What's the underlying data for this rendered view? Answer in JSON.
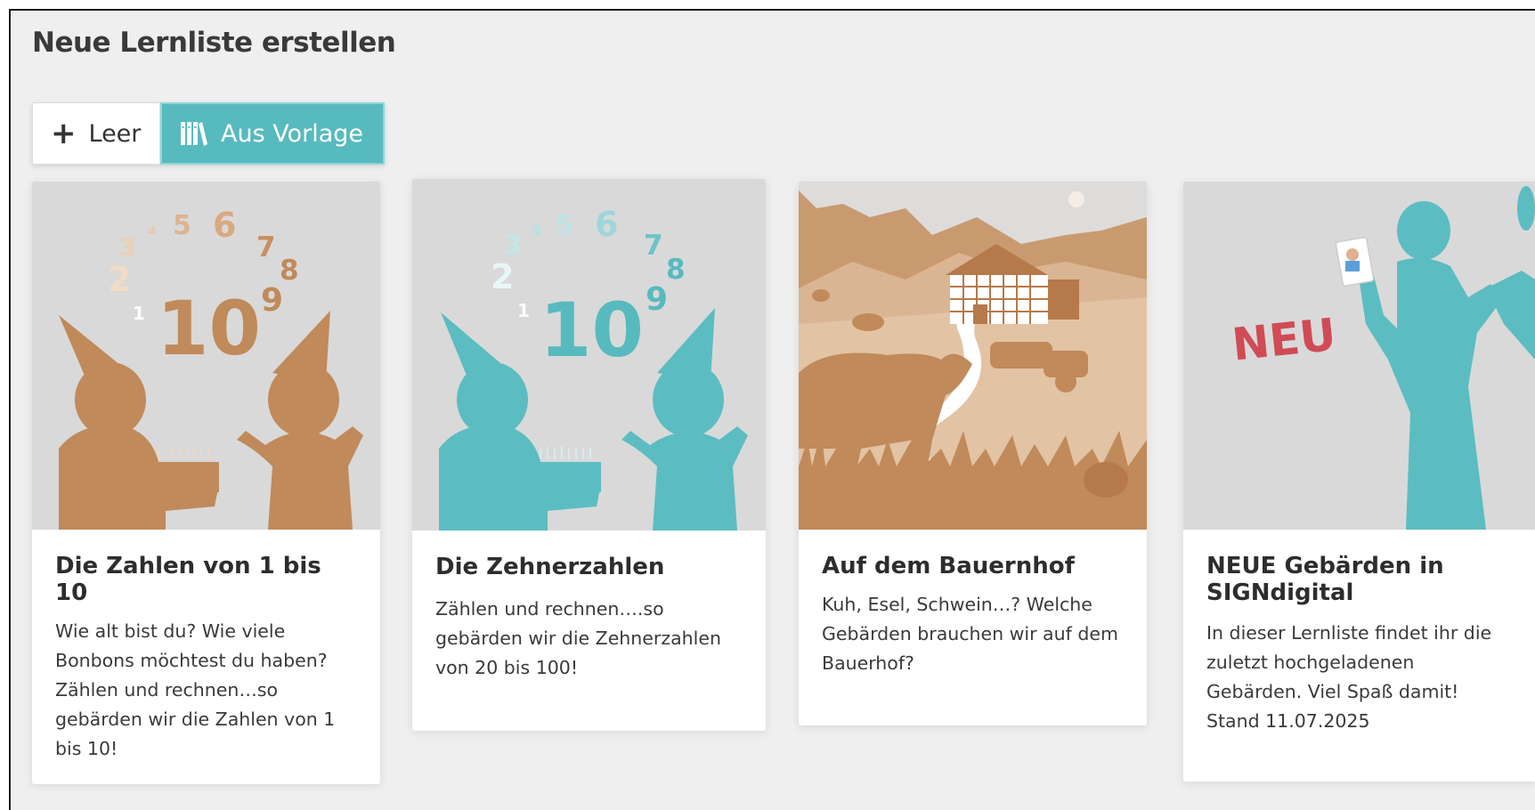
{
  "page": {
    "title": "Neue Lernliste erstellen"
  },
  "toggle": {
    "leer_label": "Leer",
    "vorlage_label": "Aus Vorlage",
    "active": "vorlage"
  },
  "colors": {
    "accent": "#57babe",
    "brown": "#c08a5a",
    "card_bg": "#ffffff",
    "page_bg": "#efefef"
  },
  "cards": [
    {
      "title": "Die Zahlen von 1 bis 10",
      "description": "Wie alt bist du? Wie viele Bonbons möchtest du haben? Zählen und rechnen…so gebärden wir die Zahlen von 1 bis 10!",
      "image": {
        "numbers": [
          "1",
          "2",
          "3",
          "4",
          "5",
          "6",
          "7",
          "8",
          "9",
          "10"
        ]
      }
    },
    {
      "title": "Die Zehnerzahlen",
      "description": "Zählen und rechnen….so gebärden wir die Zehnerzahlen von 20 bis 100!",
      "image": {
        "numbers": [
          "1",
          "2",
          "3",
          "4",
          "5",
          "6",
          "7",
          "8",
          "9",
          "10"
        ]
      }
    },
    {
      "title": "Auf dem Bauernhof",
      "description": "Kuh, Esel, Schwein…? Welche Gebärden brauchen wir auf dem Bauerhof?"
    },
    {
      "title": "NEUE Gebärden in SIGNdigital",
      "description": "In dieser Lernliste findet ihr die zuletzt hochgeladenen Gebärden. Viel Spaß damit! Stand 11.07.2025",
      "image": {
        "stamp_text": "NEU"
      }
    }
  ]
}
